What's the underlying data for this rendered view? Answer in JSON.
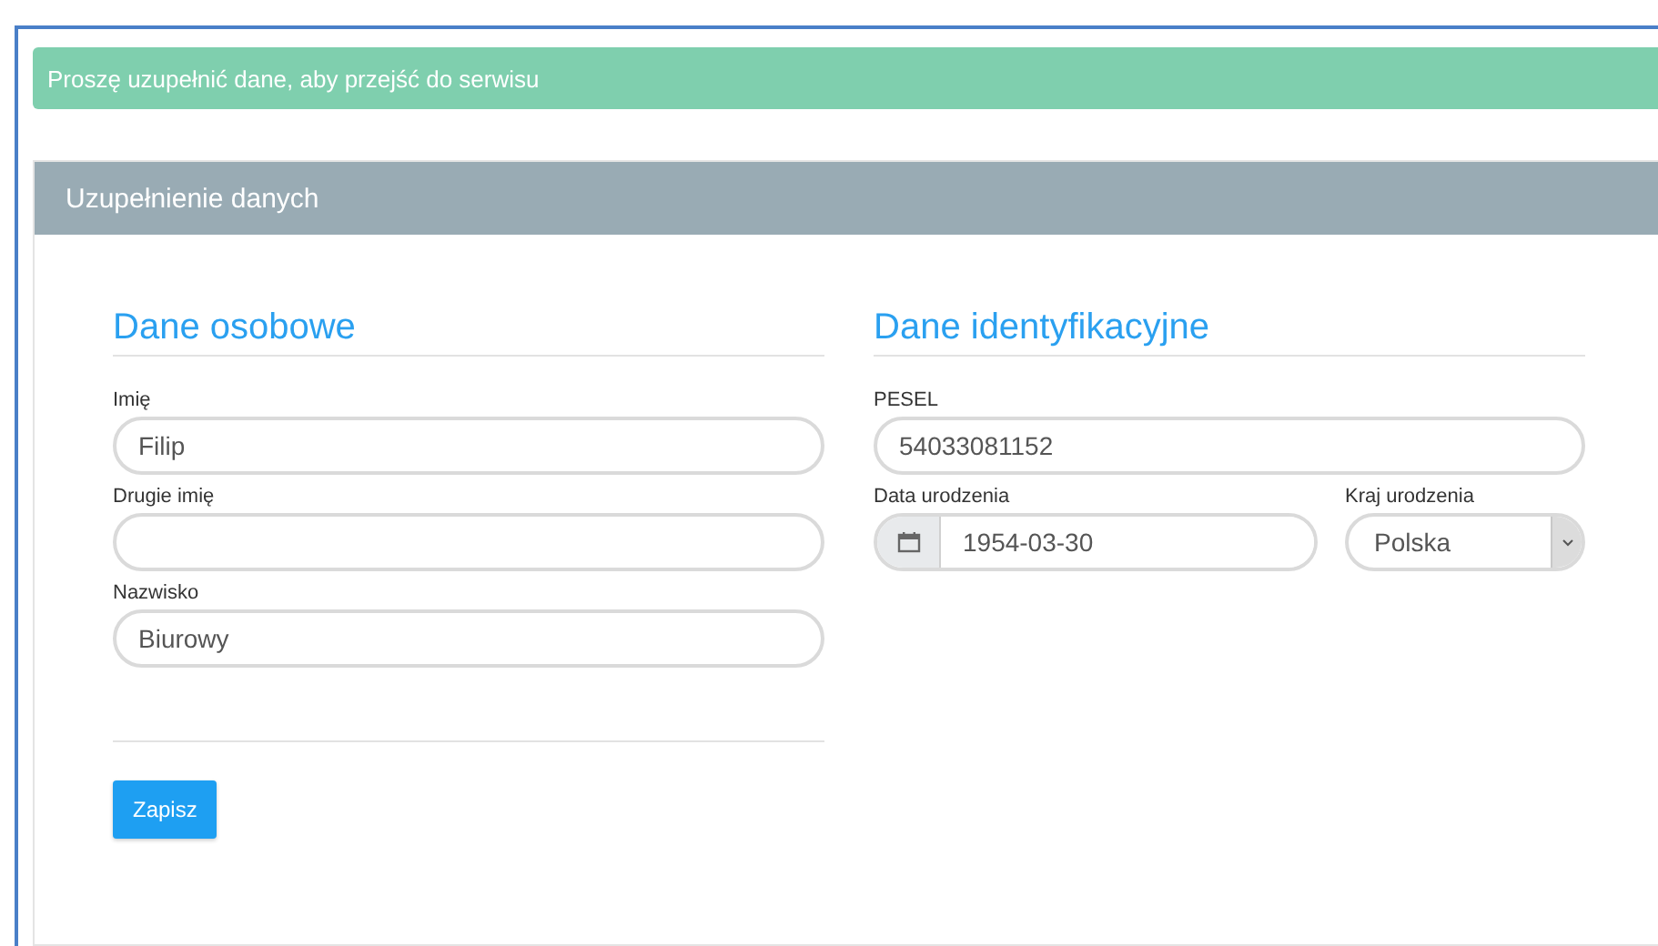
{
  "alert": "Proszę uzupełnić dane, aby przejść do serwisu",
  "panel": {
    "title": "Uzupełnienie danych"
  },
  "sections": [
    {
      "title": "Dane osobowe",
      "rows": [
        [
          {
            "kind": "text",
            "label": "Imię",
            "value": "Filip"
          }
        ],
        [
          {
            "kind": "text",
            "label": "Drugie imię"
          }
        ],
        [
          {
            "kind": "text",
            "label": "Nazwisko",
            "value": "Biurowy"
          }
        ]
      ]
    },
    {
      "title": "Dane identyfikacyjne",
      "rows": [
        [
          {
            "kind": "text",
            "label": "PESEL",
            "value": "54033081152"
          }
        ],
        [
          {
            "kind": "date",
            "label": "Data urodzenia",
            "value": "1954-03-30"
          },
          {
            "kind": "select",
            "label": "Kraj urodzenia",
            "value": "Polska"
          }
        ]
      ]
    }
  ],
  "save_button": "Zapisz"
}
